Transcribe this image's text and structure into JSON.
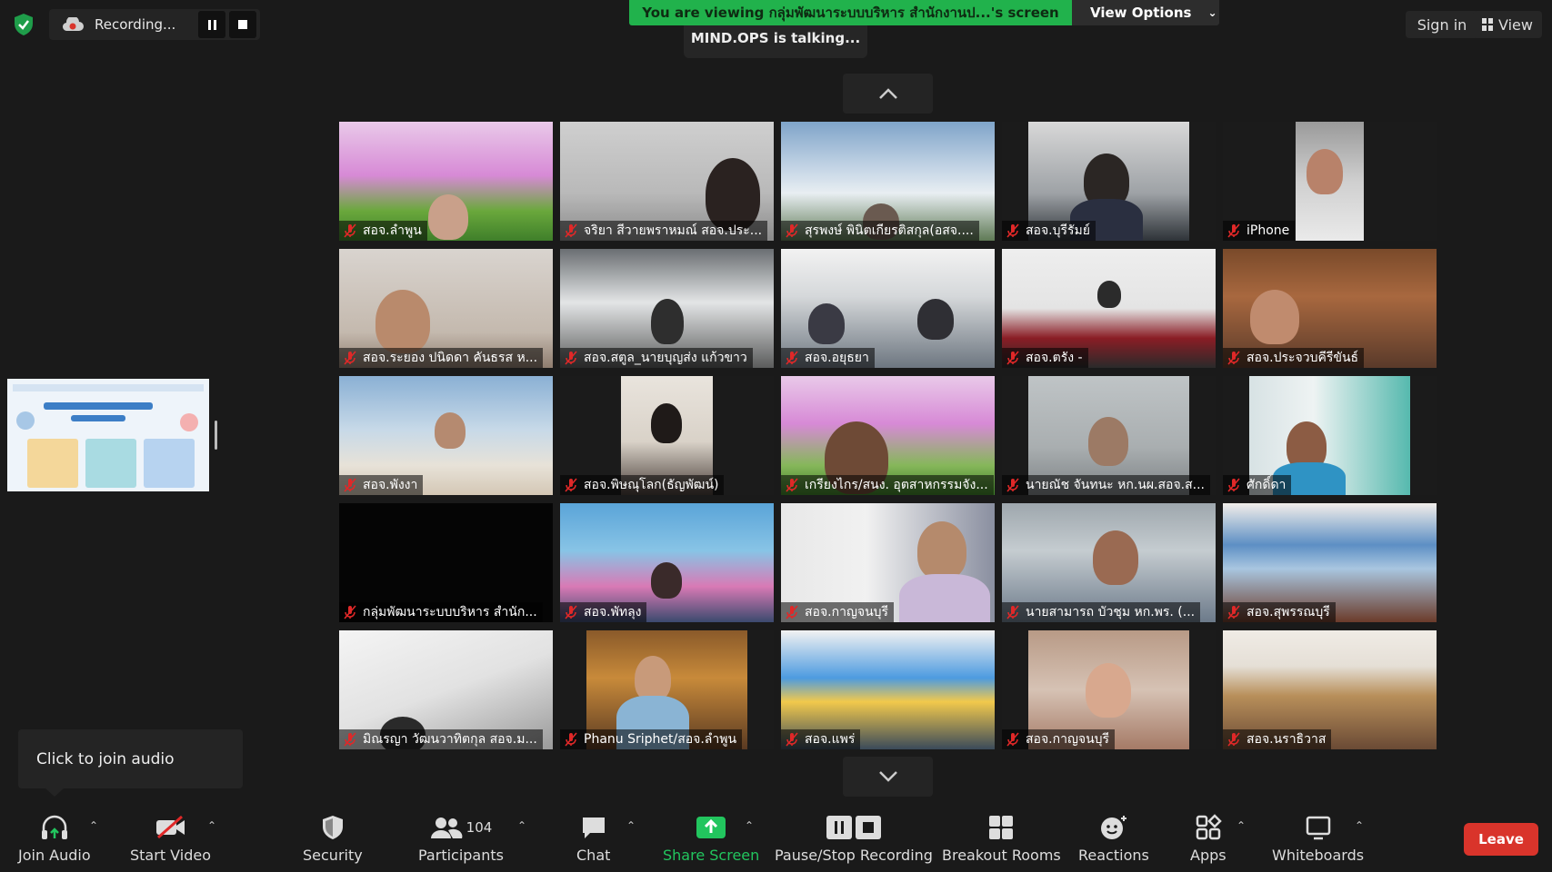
{
  "recording": {
    "status_text": "Recording..."
  },
  "share_banner": {
    "text": "You are viewing กลุ่มพัฒนาระบบบริหาร สำนักงานป...'s screen"
  },
  "view_options": {
    "label": "View Options"
  },
  "talking": {
    "text": "MIND.OPS is talking..."
  },
  "header": {
    "sign_in": "Sign in",
    "view": "View"
  },
  "tooltip": {
    "text": "Click to join audio"
  },
  "tiles": [
    {
      "name": "สอจ.ลำพูน"
    },
    {
      "name": "จริยา สีวายพราหมณ์ สอจ.ประ..."
    },
    {
      "name": "สุรพงษ์ พินิตเกียรติสกุล(อสจ...."
    },
    {
      "name": "สอจ.บุรีรัมย์"
    },
    {
      "name": "iPhone"
    },
    {
      "name": "สอจ.ระยอง ปนิดดา คันธรส ห..."
    },
    {
      "name": "สอจ.สตูล_นายบุญส่ง  แก้วขาว"
    },
    {
      "name": "สอจ.อยุธยา"
    },
    {
      "name": "สอจ.ตรัง  -"
    },
    {
      "name": "สอจ.ประจวบคีรีขันธ์"
    },
    {
      "name": "สอจ.พังงา"
    },
    {
      "name": "สอจ.พิษณุโลก(ธัญพัฒน์)"
    },
    {
      "name": "เกรียงไกร/สนง. อุตสาหกรรมจัง..."
    },
    {
      "name": "นายณัช จันทนะ หก.นผ.สอจ.ส..."
    },
    {
      "name": "ศักดิ์ดา"
    },
    {
      "name": "กลุ่มพัฒนาระบบบริหาร สำนัก..."
    },
    {
      "name": "สอจ.พัทลุง"
    },
    {
      "name": "สอจ.กาญจนบุรี"
    },
    {
      "name": "นายสามารถ บัวชุม  หก.พร. (..."
    },
    {
      "name": "สอจ.สุพรรณบุรี"
    },
    {
      "name": "มิณรญา วัฒนวาทิตกุล สอจ.ม..."
    },
    {
      "name": "Phanu Sriphet/สอจ.ลำพูน"
    },
    {
      "name": "สอจ.แพร่"
    },
    {
      "name": "สอจ.กาญจนบุรี"
    },
    {
      "name": "สอจ.นราธิวาส"
    }
  ],
  "toolbar": {
    "join_audio": "Join Audio",
    "start_video": "Start Video",
    "security": "Security",
    "participants": "Participants",
    "participant_count": "104",
    "chat": "Chat",
    "share_screen": "Share Screen",
    "pause_stop_recording": "Pause/Stop Recording",
    "breakout_rooms": "Breakout Rooms",
    "reactions": "Reactions",
    "apps": "Apps",
    "whiteboards": "Whiteboards",
    "leave": "Leave"
  },
  "colors": {
    "share_green": "#21b24c",
    "leave_red": "#d9342b",
    "share_label_green": "#22c55e"
  }
}
